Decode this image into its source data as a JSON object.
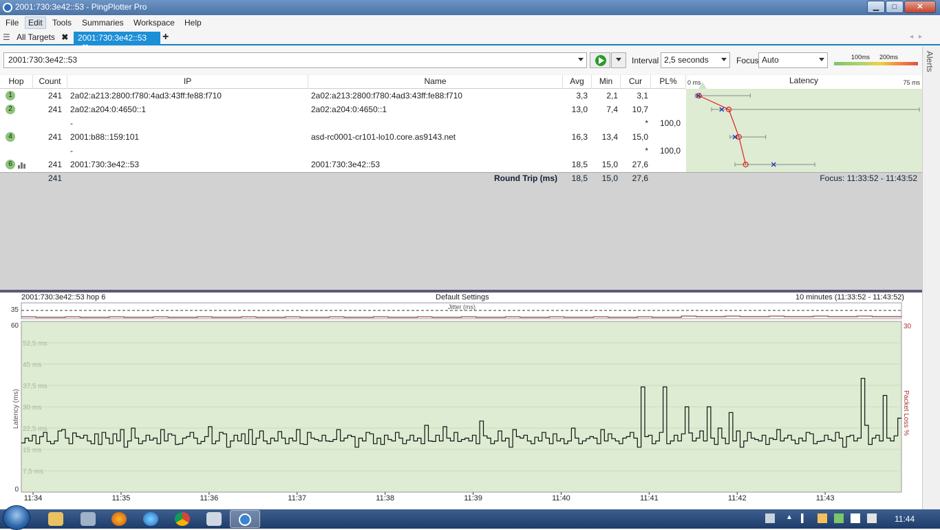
{
  "window": {
    "title": "2001:730:3e42::53 - PingPlotter Pro",
    "min": "▁",
    "max": "□",
    "close": "✕"
  },
  "menu": [
    "File",
    "Edit",
    "Tools",
    "Summaries",
    "Workspace",
    "Help"
  ],
  "tabs": {
    "all_targets": "All Targets",
    "active": "2001:730:3e42::53",
    "close_glyph": "✖",
    "add_glyph": "+",
    "nav": "◂▸"
  },
  "toolbar": {
    "target_value": "2001:730:3e42::53",
    "interval_label": "Interval",
    "interval_value": "2,5 seconds",
    "focus_label": "Focus",
    "focus_value": "Auto",
    "scale_100": "100ms",
    "scale_200": "200ms"
  },
  "alerts": "Alerts",
  "columns": {
    "hop": "Hop",
    "count": "Count",
    "ip": "IP",
    "name": "Name",
    "avg": "Avg",
    "min": "Min",
    "cur": "Cur",
    "pl": "PL%",
    "latency": "Latency"
  },
  "latency_scale": {
    "left": "0 ms",
    "right": "75 ms",
    "max_ms": 75
  },
  "hops": [
    {
      "hop": "1",
      "count": "241",
      "ip": "2a02:a213:2800:f780:4ad3:43ff:fe88:f710",
      "name": "2a02:a213:2800:f780:4ad3:43ff:fe88:f710",
      "avg": "3,3",
      "min": "2,1",
      "cur": "3,1",
      "pl": "",
      "avg_ms": 3.3,
      "min_ms": 2.1,
      "cur_ms": 3.1,
      "max_ms": 20
    },
    {
      "hop": "2",
      "count": "241",
      "ip": "2a02:a204:0:4650::1",
      "name": "2a02:a204:0:4650::1",
      "avg": "13,0",
      "min": "7,4",
      "cur": "10,7",
      "pl": "",
      "avg_ms": 13.0,
      "min_ms": 7.4,
      "cur_ms": 10.7,
      "max_ms": 75
    },
    {
      "hop": "",
      "count": "",
      "ip": "-",
      "name": "",
      "avg": "",
      "min": "",
      "cur": "*",
      "pl": "100,0"
    },
    {
      "hop": "4",
      "count": "241",
      "ip": "2001:b88::159:101",
      "name": "asd-rc0001-cr101-lo10.core.as9143.net",
      "avg": "16,3",
      "min": "13,4",
      "cur": "15,0",
      "pl": "",
      "avg_ms": 16.3,
      "min_ms": 13.4,
      "cur_ms": 15.0,
      "max_ms": 25
    },
    {
      "hop": "",
      "count": "",
      "ip": "-",
      "name": "",
      "avg": "",
      "min": "",
      "cur": "*",
      "pl": "100,0"
    },
    {
      "hop": "6",
      "count": "241",
      "ip": "2001:730:3e42::53",
      "name": "2001:730:3e42::53",
      "avg": "18,5",
      "min": "15,0",
      "cur": "27,6",
      "pl": "",
      "avg_ms": 18.5,
      "min_ms": 15.0,
      "cur_ms": 27.6,
      "max_ms": 41
    }
  ],
  "summary": {
    "count": "241",
    "label": "Round Trip (ms)",
    "avg": "18,5",
    "min": "15,0",
    "cur": "27,6",
    "focus": "Focus: 11:33:52 - 11:43:52"
  },
  "timegraph": {
    "left_title": "2001:730:3e42::53 hop 6",
    "center_title": "Default Settings",
    "right_title": "10 minutes (11:33:52 - 11:43:52)",
    "jitter_label": "Jitter (ms)",
    "jitter_max": "35",
    "y_max": "60",
    "y_min": "0",
    "pl_max": "30",
    "ylabel": "Latency (ms)",
    "ylabel_right": "Packet Loss %",
    "y_ticks": [
      "52,5 ms",
      "45 ms",
      "37,5 ms",
      "30 ms",
      "22,5 ms",
      "15 ms",
      "7,5 ms"
    ],
    "x_ticks": [
      "11:34",
      "11:35",
      "11:36",
      "11:37",
      "11:38",
      "11:39",
      "11:40",
      "11:41",
      "11:42",
      "11:43"
    ]
  },
  "chart_data": {
    "type": "line",
    "ylabel": "Latency (ms)",
    "ylim": [
      0,
      60
    ],
    "x_range": [
      "11:33:52",
      "11:43:52"
    ],
    "samples_per_minute": 24,
    "baseline_ms": [
      17,
      19,
      18,
      20,
      17,
      18,
      21,
      19,
      17,
      18,
      20,
      18,
      19,
      17,
      22,
      18,
      19,
      20,
      18,
      17,
      19,
      18,
      21,
      19
    ],
    "spikes": [
      {
        "time": "11:34:20",
        "ms": 22
      },
      {
        "time": "11:35:00",
        "ms": 22
      },
      {
        "time": "11:36:00",
        "ms": 23
      },
      {
        "time": "11:37:00",
        "ms": 22
      },
      {
        "time": "11:38:40",
        "ms": 23
      },
      {
        "time": "11:39:05",
        "ms": 25
      },
      {
        "time": "11:40:55",
        "ms": 37
      },
      {
        "time": "11:41:10",
        "ms": 37
      },
      {
        "time": "11:41:25",
        "ms": 30
      },
      {
        "time": "11:41:40",
        "ms": 30
      },
      {
        "time": "11:41:55",
        "ms": 28
      },
      {
        "time": "11:43:25",
        "ms": 40
      },
      {
        "time": "11:43:40",
        "ms": 34
      },
      {
        "time": "11:43:50",
        "ms": 26
      }
    ]
  },
  "taskbar": {
    "clock": "11:44"
  }
}
